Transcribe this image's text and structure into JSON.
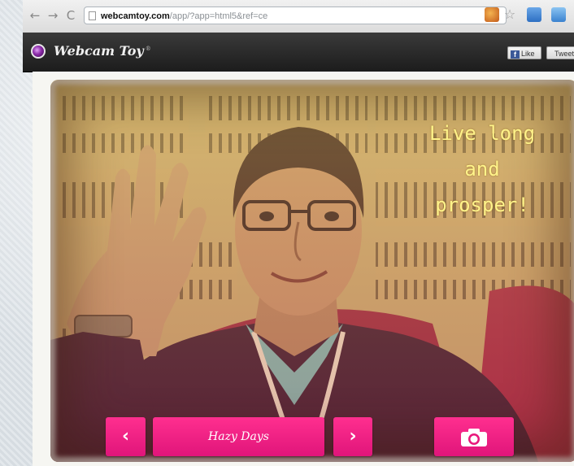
{
  "browser": {
    "url_host": "webcamtoy.com",
    "url_path": "/app/?app=html5&ref=ce"
  },
  "app": {
    "title": "Webcam Toy",
    "title_mark": "®",
    "like_label": "Like",
    "tweet_label": "Tweet"
  },
  "photo": {
    "caption_lines": [
      "Live long",
      "and",
      "prosper!"
    ],
    "caption_color": "#fff38a"
  },
  "controls": {
    "prev_glyph": "‹",
    "next_glyph": "›",
    "effect_name": "Hazy Days",
    "camera_icon": "camera-icon",
    "accent_color": "#f0207f"
  }
}
